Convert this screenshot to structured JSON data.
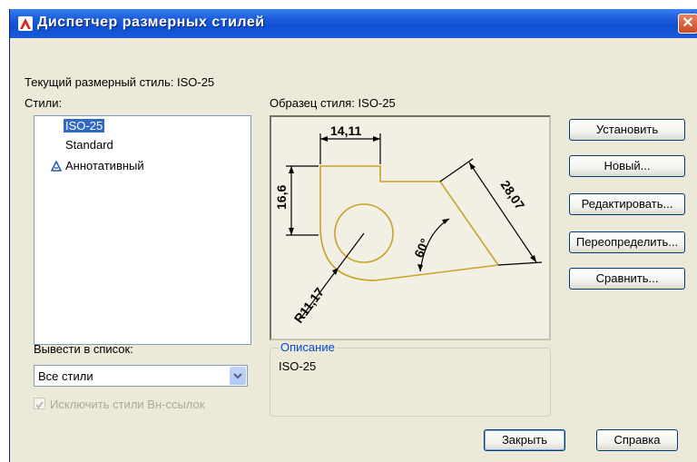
{
  "window": {
    "title": "Диспетчер размерных стилей",
    "close_glyph": "✕"
  },
  "current_style_label": "Текущий размерный стиль: ISO-25",
  "styles": {
    "label": "Стили:",
    "items": [
      {
        "label": "ISO-25",
        "selected": true
      },
      {
        "label": "Standard",
        "selected": false
      },
      {
        "label": "Аннотативный",
        "selected": false,
        "icon": "annotative-icon"
      }
    ]
  },
  "preview": {
    "label": "Образец стиля: ISO-25",
    "dims": {
      "width": "14,11",
      "height": "16,6",
      "diagonal": "28,07",
      "angle": "60°",
      "radius": "R11,17"
    }
  },
  "list_filter": {
    "label": "Вывести в список:",
    "value": "Все стили"
  },
  "exclude_xref": {
    "label": "Исключить стили Вн-ссылок",
    "checked": true,
    "enabled": false
  },
  "description": {
    "legend": "Описание",
    "text": "ISO-25"
  },
  "buttons": {
    "set_current": "Установить",
    "new": "Новый...",
    "modify": "Редактировать...",
    "override": "Переопределить...",
    "compare": "Сравнить...",
    "close": "Закрыть",
    "help": "Справка"
  },
  "colors": {
    "titlebar": "#0e4fd4",
    "selection": "#316ac5",
    "drawing": "#c9a227",
    "dialog": "#ece9d8"
  }
}
